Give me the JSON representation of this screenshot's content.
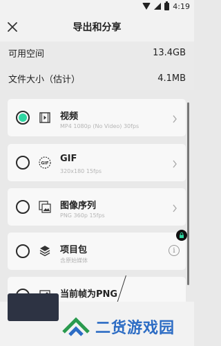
{
  "status_bar": {
    "time": "4:19"
  },
  "header": {
    "title": "导出和分享"
  },
  "info": {
    "available_space_label": "可用空间",
    "available_space_value": "13.4GB",
    "file_size_label": "文件大小（估计）",
    "file_size_value": "4.1MB"
  },
  "options": [
    {
      "title": "视频",
      "subtitle": "MP4 1080p (No Video) 30fps",
      "selected": true,
      "icon": "video-icon"
    },
    {
      "title": "GIF",
      "subtitle": "320x180 15fps",
      "selected": false,
      "icon": "gif-icon"
    },
    {
      "title": "图像序列",
      "subtitle": "PNG 360p 15fps",
      "selected": false,
      "icon": "image-sequence-icon"
    },
    {
      "title": "项目包",
      "subtitle": "含原始媒体",
      "selected": false,
      "icon": "package-icon"
    },
    {
      "title": "当前帧为PNG",
      "subtitle": "",
      "selected": false,
      "icon": "image-icon"
    }
  ],
  "watermark": {
    "text": "二货游戏园"
  },
  "colors": {
    "accent": "#2fd6a2",
    "button_dark": "#2d3343",
    "watermark_blue": "#2c6cc4"
  }
}
